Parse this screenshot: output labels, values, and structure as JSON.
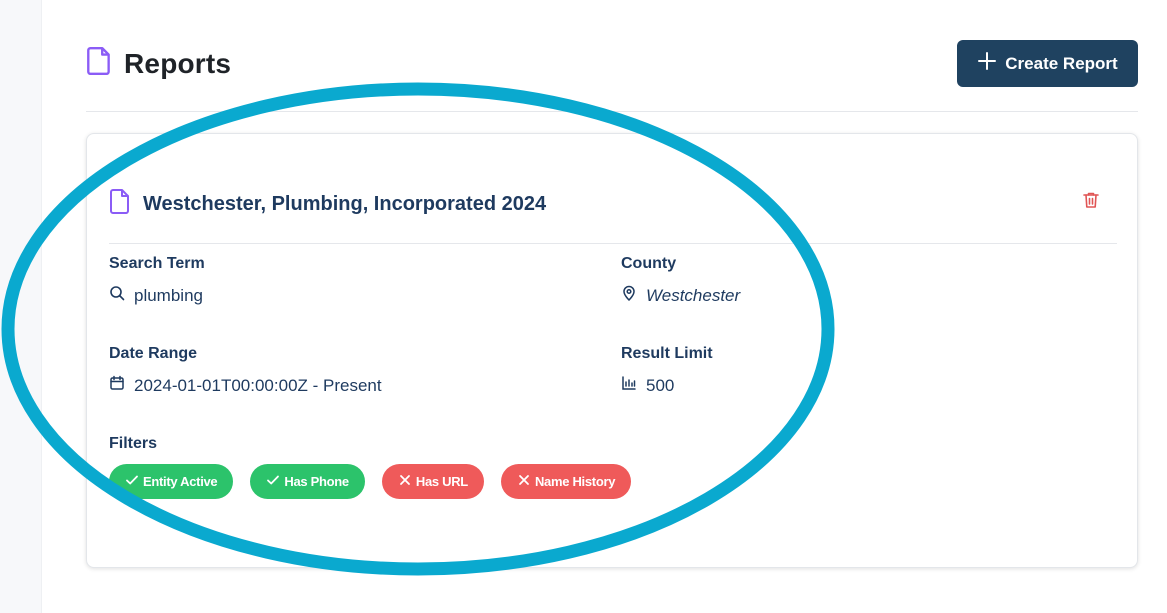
{
  "page": {
    "title": "Reports",
    "create_button_label": "Create Report"
  },
  "report": {
    "title": "Westchester, Plumbing, Incorporated 2024",
    "fields": {
      "search_term": {
        "label": "Search Term",
        "value": "plumbing"
      },
      "county": {
        "label": "County",
        "value": "Westchester"
      },
      "date_range": {
        "label": "Date Range",
        "value": "2024-01-01T00:00:00Z - Present"
      },
      "result_limit": {
        "label": "Result Limit",
        "value": "500"
      }
    },
    "filters_label": "Filters",
    "filters": [
      {
        "label": "Entity Active",
        "state": "on"
      },
      {
        "label": "Has Phone",
        "state": "on"
      },
      {
        "label": "Has URL",
        "state": "off"
      },
      {
        "label": "Name History",
        "state": "off"
      }
    ]
  },
  "colors": {
    "primary_button": "#1f4260",
    "title_text": "#1e3a5f",
    "icon_accent": "#8b5cf6",
    "filter_on": "#2cc36b",
    "filter_off": "#ef5a5a",
    "delete_icon": "#e05555",
    "annotation_ring": "#0aa9cf"
  }
}
